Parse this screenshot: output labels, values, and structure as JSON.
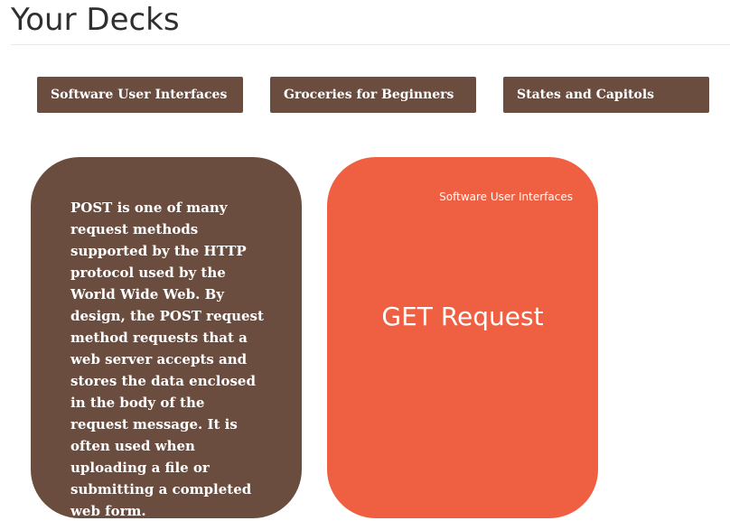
{
  "page": {
    "title": "Your Decks"
  },
  "decks": [
    {
      "label": "Software User Interfaces"
    },
    {
      "label": "Groceries for Beginners"
    },
    {
      "label": "States and Capitols"
    }
  ],
  "cards": {
    "back": {
      "text": "POST is one of many request methods supported by the HTTP protocol used by the World Wide Web. By design, the POST request method requests that a web server accepts and stores the data enclosed in the body of the request message. It is often used when uploading a file or submitting a completed web form."
    },
    "front": {
      "deck_label": "Software User Interfaces",
      "term": "GET Request"
    }
  },
  "colors": {
    "deck_button": "#6b4d3f",
    "card_back": "#6b4d3f",
    "card_front": "#ef5f41"
  }
}
